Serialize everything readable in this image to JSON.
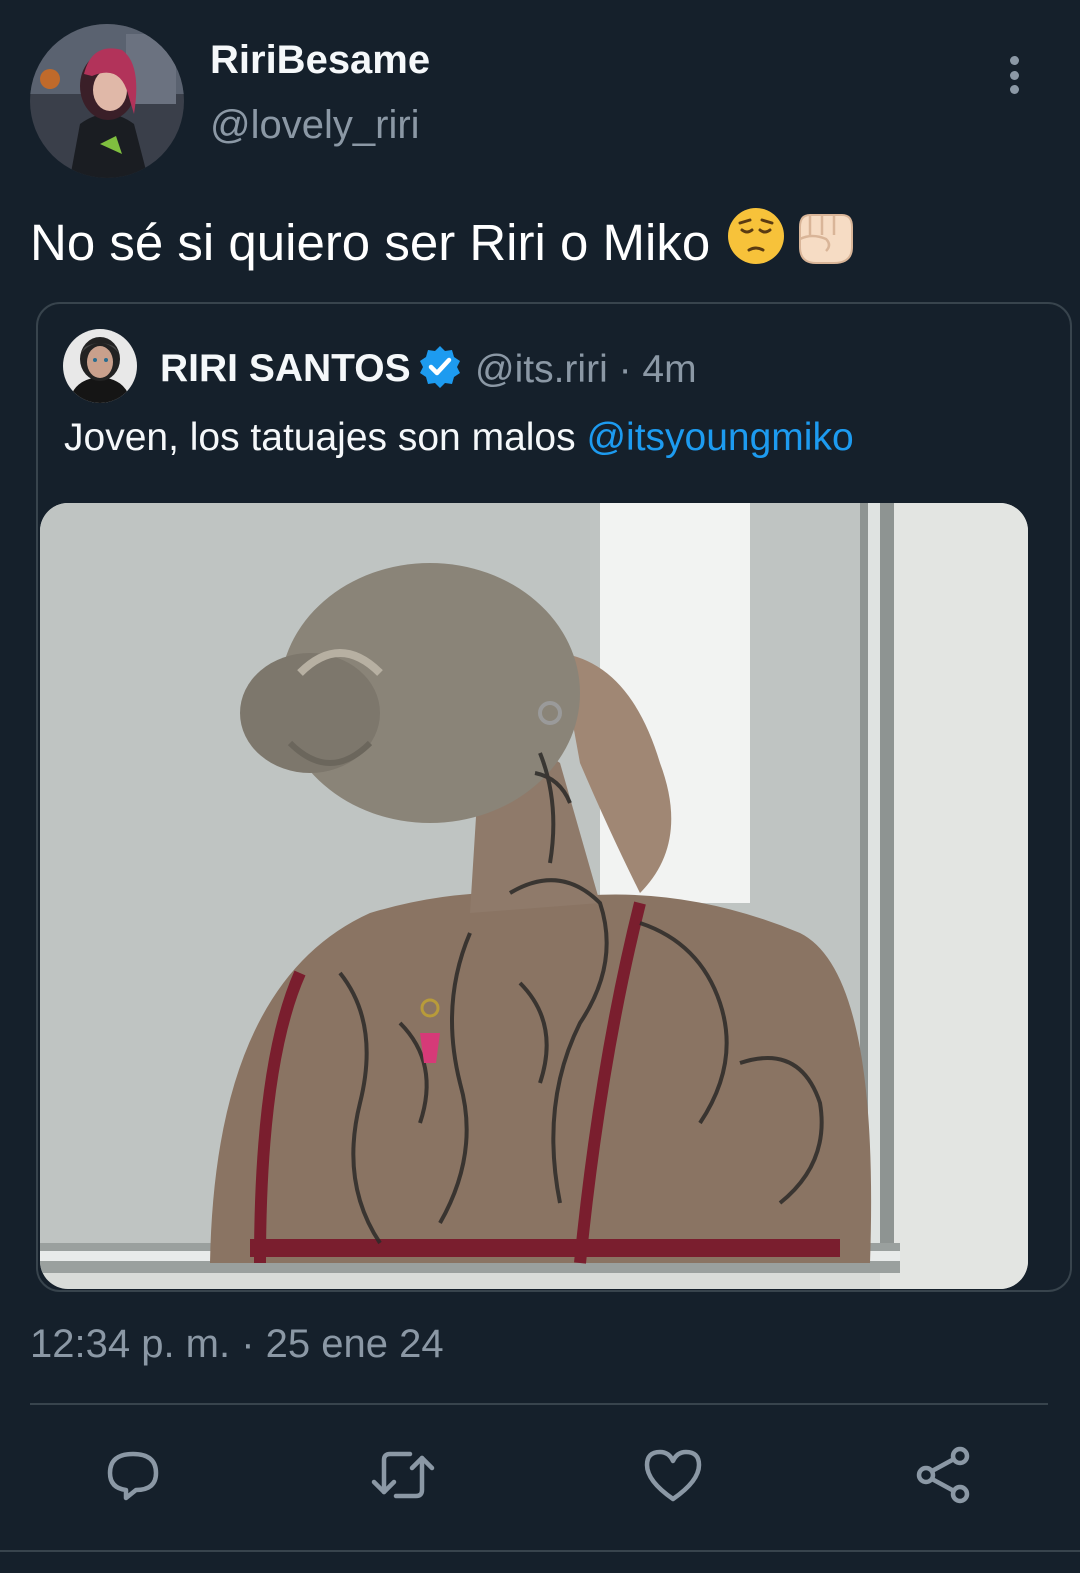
{
  "author": {
    "display_name": "RiriBesame",
    "handle": "@lovely_riri"
  },
  "tweet": {
    "text": "No sé si quiero ser Riri o Miko",
    "emojis": [
      "pensive-face",
      "raised-fist-light-skin"
    ]
  },
  "quoted": {
    "display_name": "RIRI SANTOS",
    "verified": true,
    "meta": "@its.riri · 4m",
    "text": "Joven, los tatuajes son malos ",
    "mention": "@itsyoungmiko",
    "media_alt": "photo"
  },
  "timestamp": "12:34 p. m. · 25 ene 24",
  "actions": [
    "reply-icon",
    "retweet-icon",
    "like-icon",
    "share-icon"
  ],
  "colors": {
    "background": "#15202b",
    "border": "#38444d",
    "secondary_text": "#8b98a5",
    "accent": "#1d9bf0"
  }
}
